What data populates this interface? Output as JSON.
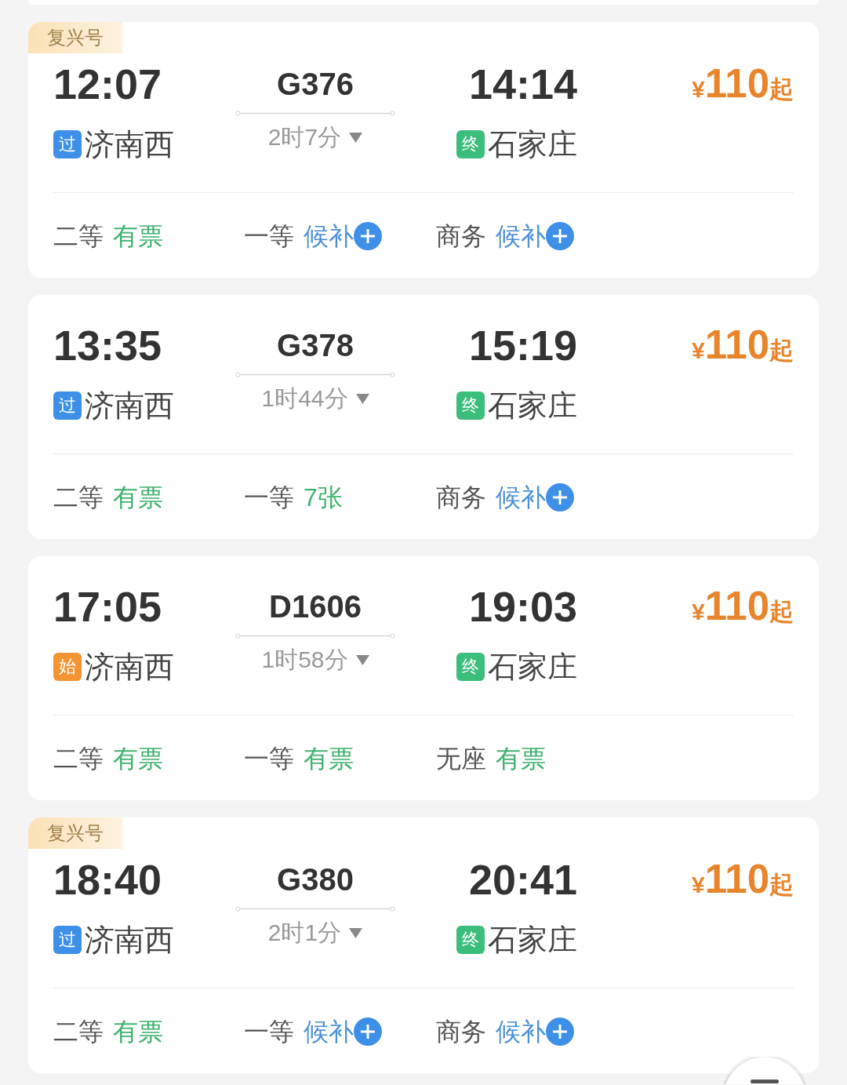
{
  "trains": [
    {
      "brand": "复兴号",
      "depart": {
        "time": "12:07",
        "station": {
          "kind": "pass",
          "tag": "过",
          "name": "济南西"
        }
      },
      "train_no": "G376",
      "duration": "2时7分",
      "arrive": {
        "time": "14:14",
        "station": {
          "kind": "end",
          "tag": "终",
          "name": "石家庄"
        }
      },
      "price": {
        "currency": "¥",
        "amount": "110",
        "suffix": "起"
      },
      "seats": [
        {
          "class": "二等",
          "status": "有票",
          "kind": "available"
        },
        {
          "class": "一等",
          "status": "候补",
          "kind": "waitlist"
        },
        {
          "class": "商务",
          "status": "候补",
          "kind": "waitlist"
        }
      ]
    },
    {
      "depart": {
        "time": "13:35",
        "station": {
          "kind": "pass",
          "tag": "过",
          "name": "济南西"
        }
      },
      "train_no": "G378",
      "duration": "1时44分",
      "arrive": {
        "time": "15:19",
        "station": {
          "kind": "end",
          "tag": "终",
          "name": "石家庄"
        }
      },
      "price": {
        "currency": "¥",
        "amount": "110",
        "suffix": "起"
      },
      "seats": [
        {
          "class": "二等",
          "status": "有票",
          "kind": "available"
        },
        {
          "class": "一等",
          "status": "7张",
          "kind": "available"
        },
        {
          "class": "商务",
          "status": "候补",
          "kind": "waitlist"
        }
      ]
    },
    {
      "depart": {
        "time": "17:05",
        "station": {
          "kind": "start",
          "tag": "始",
          "name": "济南西"
        }
      },
      "train_no": "D1606",
      "duration": "1时58分",
      "arrive": {
        "time": "19:03",
        "station": {
          "kind": "end",
          "tag": "终",
          "name": "石家庄"
        }
      },
      "price": {
        "currency": "¥",
        "amount": "110",
        "suffix": "起"
      },
      "seats": [
        {
          "class": "二等",
          "status": "有票",
          "kind": "available"
        },
        {
          "class": "一等",
          "status": "有票",
          "kind": "available"
        },
        {
          "class": "无座",
          "status": "有票",
          "kind": "available"
        }
      ]
    },
    {
      "brand": "复兴号",
      "depart": {
        "time": "18:40",
        "station": {
          "kind": "pass",
          "tag": "过",
          "name": "济南西"
        }
      },
      "train_no": "G380",
      "duration": "2时1分",
      "arrive": {
        "time": "20:41",
        "station": {
          "kind": "end",
          "tag": "终",
          "name": "石家庄"
        }
      },
      "price": {
        "currency": "¥",
        "amount": "110",
        "suffix": "起"
      },
      "seats": [
        {
          "class": "二等",
          "status": "有票",
          "kind": "available"
        },
        {
          "class": "一等",
          "status": "候补",
          "kind": "waitlist"
        },
        {
          "class": "商务",
          "status": "候补",
          "kind": "waitlist"
        }
      ]
    }
  ]
}
